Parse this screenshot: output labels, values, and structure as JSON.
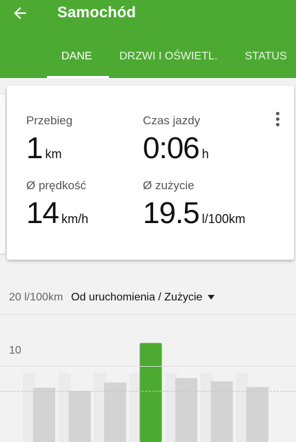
{
  "appbar": {
    "title": "Samochód",
    "tabs": [
      {
        "label": "DANE",
        "active": true
      },
      {
        "label": "DRZWI I OŚWIETL.",
        "active": false
      },
      {
        "label": "STATUS",
        "active": false
      }
    ],
    "color": "#4caa32"
  },
  "stats": {
    "mileage": {
      "label": "Przebieg",
      "value": "1",
      "unit": "km"
    },
    "drive_time": {
      "label": "Czas jazdy",
      "value": "0:06",
      "unit": "h"
    },
    "avg_speed": {
      "label": "Ø prędkość",
      "value": "14",
      "unit": "km/h"
    },
    "avg_consumption": {
      "label": "Ø zużycie",
      "value": "19.5",
      "unit": "l/100km"
    }
  },
  "chart_data": {
    "type": "bar",
    "y_axis_labels": [
      "20 l/100km",
      "10"
    ],
    "selector": "Od uruchomienia / Zużycie",
    "ylim": [
      0,
      20
    ],
    "values": [
      8.5,
      8.0,
      9.3,
      15.5,
      10.0,
      9.5,
      8.6
    ],
    "highlight_index": 3,
    "average": 8.0,
    "colors": {
      "bar": "#d3d3d3",
      "highlight": "#4caa32",
      "background_bar": "#ebebeb"
    }
  }
}
